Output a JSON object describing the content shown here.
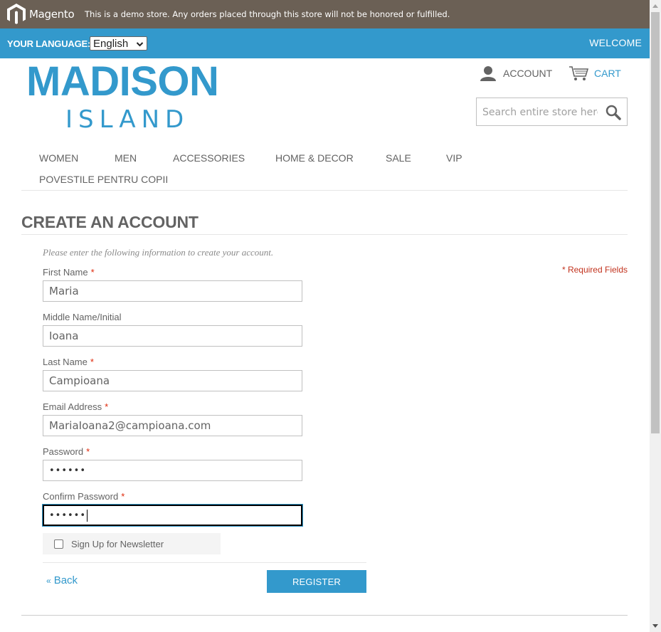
{
  "demo_bar": {
    "brand": "Magento",
    "notice": "This is a demo store. Any orders placed through this store will not be honored or fulfilled.",
    "background": "#6b6055"
  },
  "lang_bar": {
    "label": "YOUR LANGUAGE:",
    "selected_language": "English",
    "welcome": "WELCOME",
    "background": "#3399cc"
  },
  "logo": {
    "line1": "MADISON",
    "line2": "ISLAND",
    "color": "#3399cc"
  },
  "header": {
    "account_label": "ACCOUNT",
    "account_icon": "user-icon",
    "cart_label": "CART",
    "cart_icon": "cart-icon",
    "search_placeholder": "Search entire store here...",
    "search_icon": "search-icon"
  },
  "nav": {
    "items": [
      "WOMEN",
      "MEN",
      "ACCESSORIES",
      "HOME & DECOR",
      "SALE",
      "VIP",
      "POVESTILE PENTRU COPII"
    ]
  },
  "page": {
    "title": "CREATE AN ACCOUNT",
    "intro": "Please enter the following information to create your account.",
    "required_note": "* Required Fields"
  },
  "form": {
    "first_name": {
      "label": "First Name",
      "value": "Maria",
      "required": "*"
    },
    "middle_name": {
      "label": "Middle Name/Initial",
      "value": "Ioana"
    },
    "last_name": {
      "label": "Last Name",
      "value": "Campioana",
      "required": "*"
    },
    "email": {
      "label": "Email Address",
      "value": "MariaIoana2@campioana.com",
      "required": "*"
    },
    "password": {
      "label": "Password",
      "value": "••••••",
      "required": "*"
    },
    "confirm_password": {
      "label": "Confirm Password",
      "value": "••••••",
      "required": "*"
    },
    "newsletter_label": "Sign Up for Newsletter",
    "back_label": "Back",
    "back_prefix": "«",
    "register_label": "REGISTER"
  },
  "colors": {
    "accent": "#3399cc",
    "required": "#df280a",
    "text": "#636363"
  }
}
